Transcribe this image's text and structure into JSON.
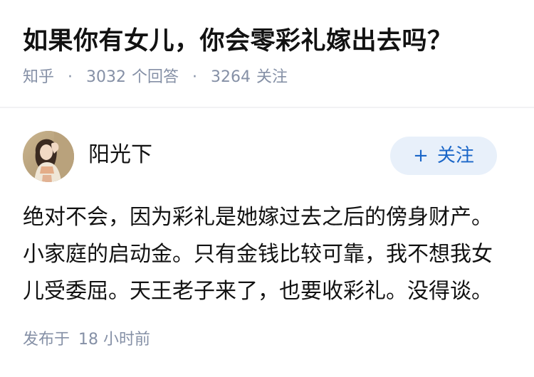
{
  "question": {
    "title": "如果你有女儿，你会零彩礼嫁出去吗？",
    "source": "知乎",
    "separator": "·",
    "answer_count": "3032",
    "answer_label": "个回答",
    "follower_count": "3264",
    "follower_label": "关注"
  },
  "author": {
    "name": "阳光下",
    "avatar_icon": "user-avatar-photo",
    "follow_plus": "+",
    "follow_label": "关注"
  },
  "answer": {
    "lines": [
      "绝对不会，因为彩礼是她嫁过去之后的傍身财产。",
      "小家庭的启动金。只有金钱比较可靠，我不想我女",
      "儿受委屈。天王老子来了，也要收彩礼。没得谈。"
    ]
  },
  "footer": {
    "published_label": "发布于",
    "published_time": "18 小时前"
  },
  "colors": {
    "text_primary": "#121212",
    "text_meta": "#8590a6",
    "follow_bg": "#e8f0fa",
    "follow_text": "#1a66c8"
  }
}
